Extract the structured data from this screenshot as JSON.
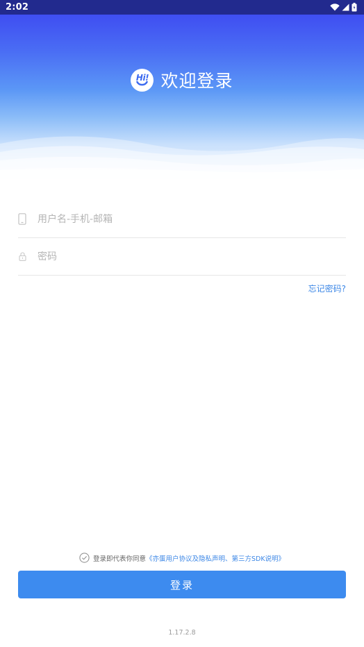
{
  "status_bar": {
    "time": "2:02",
    "icons": [
      "wifi-icon",
      "signal-icon",
      "battery-icon"
    ]
  },
  "header": {
    "logo_text": "Hi!",
    "title": "欢迎登录"
  },
  "form": {
    "username": {
      "placeholder": "用户名-手机-邮箱",
      "value": "",
      "icon": "phone-icon"
    },
    "password": {
      "placeholder": "密码",
      "value": "",
      "icon": "lock-icon"
    },
    "forgot_password": "忘记密码?"
  },
  "agreement": {
    "prefix": "登录即代表你同意",
    "link": "《亦蛋用户协议及隐私声明、第三方SDK说明》",
    "checked": false
  },
  "login_button": "登录",
  "version": "1.17.2.8",
  "colors": {
    "status_bar": "#222a8e",
    "primary": "#3d8bef",
    "link": "#3c87e6",
    "gradient_top": "#3f4ef2"
  }
}
